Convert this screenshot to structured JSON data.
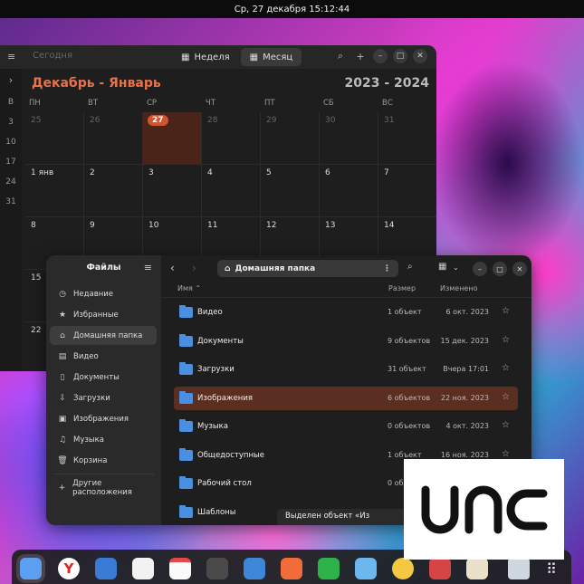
{
  "topbar": {
    "clock": "Ср, 27 декабря  15:12:44"
  },
  "calendar": {
    "today_label": "Сегодня",
    "views": [
      "Неделя",
      "Месяц"
    ],
    "title": "Декабрь - Январь",
    "year": "2023 - 2024",
    "weekdays": [
      "ПН",
      "ВТ",
      "СР",
      "ЧТ",
      "ПТ",
      "СБ",
      "ВС"
    ],
    "week_numbers": [
      "В",
      "3",
      "10",
      "17",
      "24",
      "31"
    ],
    "weeks": [
      [
        "25",
        "26",
        "27",
        "28",
        "29",
        "30",
        "31"
      ],
      [
        "1 янв",
        "2",
        "3",
        "4",
        "5",
        "6",
        "7"
      ],
      [
        "8",
        "9",
        "10",
        "11",
        "12",
        "13",
        "14"
      ],
      [
        "15",
        "",
        "",
        "",
        "",
        "",
        ""
      ],
      [
        "22",
        "",
        "",
        "",
        "",
        "",
        ""
      ]
    ],
    "colors": {
      "accent": "#e8734a",
      "today_fill": "#d2532e"
    }
  },
  "files": {
    "sidebar_title": "Файлы",
    "sidebar": [
      {
        "label": "Недавние",
        "icon": "clock-icon"
      },
      {
        "label": "Избранные",
        "icon": "star-icon"
      },
      {
        "label": "Домашняя папка",
        "icon": "home-icon"
      },
      {
        "label": "Видео",
        "icon": "video-icon"
      },
      {
        "label": "Документы",
        "icon": "document-icon"
      },
      {
        "label": "Загрузки",
        "icon": "download-icon"
      },
      {
        "label": "Изображения",
        "icon": "image-icon"
      },
      {
        "label": "Музыка",
        "icon": "music-icon"
      },
      {
        "label": "Корзина",
        "icon": "trash-icon"
      },
      {
        "label": "Другие расположения",
        "icon": "plus-icon"
      }
    ],
    "path": "Домашняя папка",
    "columns": {
      "name": "Имя",
      "size": "Размер",
      "modified": "Изменено"
    },
    "rows": [
      {
        "name": "Видео",
        "size": "1 объект",
        "date": "6 окт. 2023"
      },
      {
        "name": "Документы",
        "size": "9 объектов",
        "date": "15 дек. 2023"
      },
      {
        "name": "Загрузки",
        "size": "31 объект",
        "date": "Вчера 17:01"
      },
      {
        "name": "Изображения",
        "size": "6 объектов",
        "date": "22 ноя. 2023"
      },
      {
        "name": "Музыка",
        "size": "0 объектов",
        "date": "4 окт. 2023"
      },
      {
        "name": "Общедоступные",
        "size": "1 объект",
        "date": "16 ноя. 2023"
      },
      {
        "name": "Рабочий стол",
        "size": "0 об",
        "date": ""
      },
      {
        "name": "Шаблоны",
        "size": "",
        "date": ""
      }
    ],
    "status_toast": "Выделен объект «Из"
  },
  "logo": {
    "text": "unc"
  },
  "dock_apps": [
    "files-app",
    "yandex-browser",
    "mail",
    "notes",
    "calendar",
    "clock",
    "text-editor",
    "presentation",
    "spreadsheet",
    "image-viewer",
    "music",
    "photos",
    "document-viewer",
    "trash",
    "app-grid"
  ]
}
